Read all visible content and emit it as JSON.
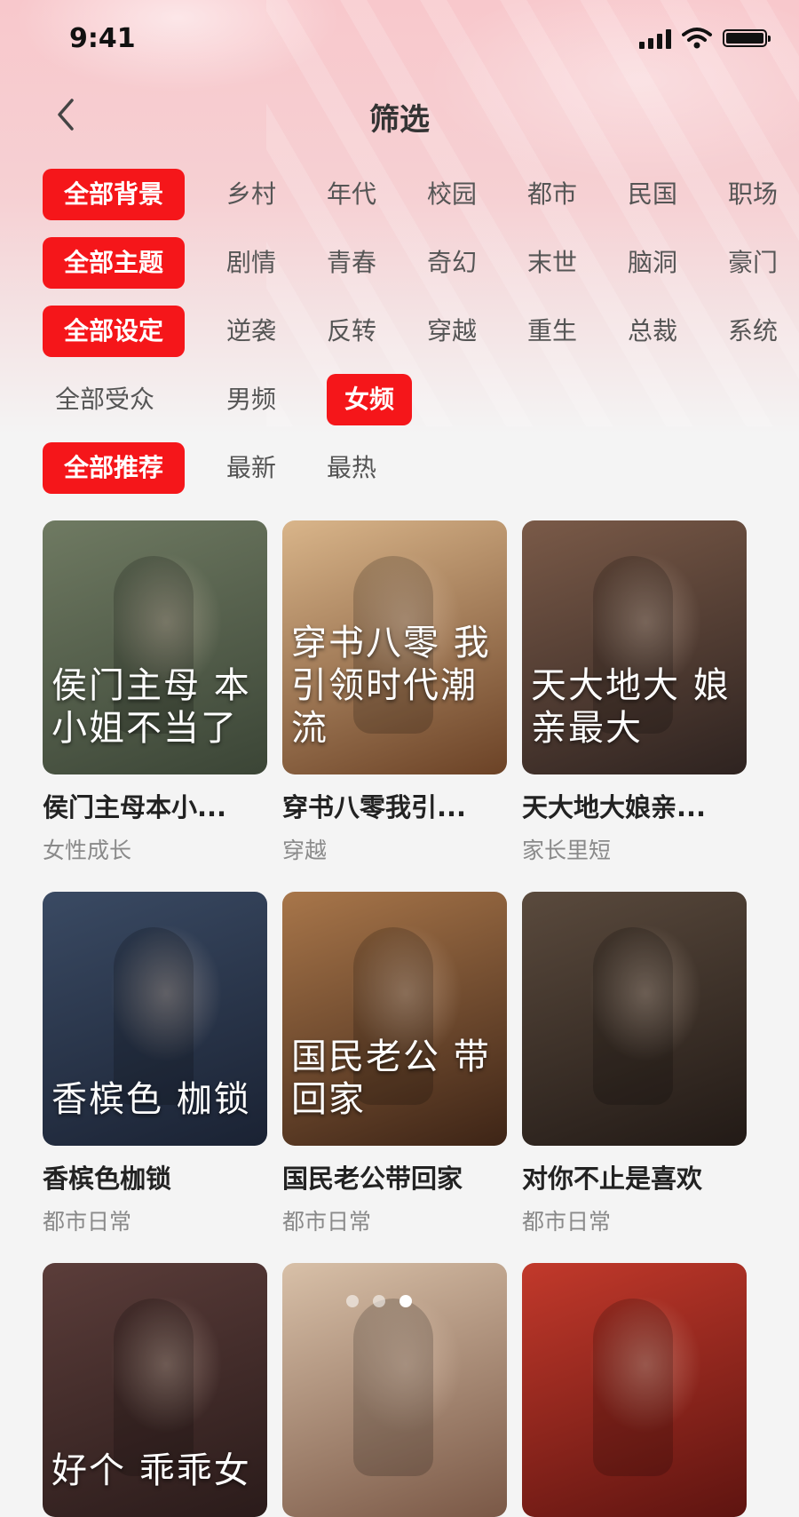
{
  "status_bar": {
    "time": "9:41"
  },
  "nav": {
    "title": "筛选"
  },
  "filters": [
    {
      "items": [
        "全部背景",
        "乡村",
        "年代",
        "校园",
        "都市",
        "民国",
        "职场"
      ],
      "active": 0
    },
    {
      "items": [
        "全部主题",
        "剧情",
        "青春",
        "奇幻",
        "末世",
        "脑洞",
        "豪门"
      ],
      "active": 0
    },
    {
      "items": [
        "全部设定",
        "逆袭",
        "反转",
        "穿越",
        "重生",
        "总裁",
        "系统"
      ],
      "active": 0
    },
    {
      "items": [
        "全部受众",
        "男频",
        "女频"
      ],
      "active": 2
    },
    {
      "items": [
        "全部推荐",
        "最新",
        "最热"
      ],
      "active": 0
    }
  ],
  "cards": [
    {
      "title": "侯门主母本小...",
      "tag": "女性成长",
      "poster_text": "侯门主母 本小姐不当了",
      "colors": [
        "#6f7a62",
        "#3b4536"
      ]
    },
    {
      "title": "穿书八零我引...",
      "tag": "穿越",
      "poster_text": "穿书八零 我引领时代潮流",
      "colors": [
        "#d9b58a",
        "#6b4226"
      ]
    },
    {
      "title": "天大地大娘亲...",
      "tag": "家长里短",
      "poster_text": "天大地大 娘亲最大",
      "colors": [
        "#7a5a48",
        "#2e2320"
      ]
    },
    {
      "title": "香槟色枷锁",
      "tag": "都市日常",
      "poster_text": "香槟色 枷锁",
      "colors": [
        "#3a4a63",
        "#1a2233"
      ]
    },
    {
      "title": "国民老公带回家",
      "tag": "都市日常",
      "poster_text": "国民老公 带回家",
      "colors": [
        "#a8764a",
        "#3d2416"
      ]
    },
    {
      "title": "对你不止是喜欢",
      "tag": "都市日常",
      "poster_text": "",
      "colors": [
        "#5a4a3d",
        "#221a16"
      ]
    },
    {
      "title": "",
      "tag": "",
      "poster_text": "好个 乖乖女",
      "colors": [
        "#5b3d3a",
        "#2a1b1a"
      ]
    },
    {
      "title": "",
      "tag": "",
      "poster_text": "",
      "colors": [
        "#d8c0a8",
        "#7a5846"
      ]
    },
    {
      "title": "",
      "tag": "",
      "poster_text": "",
      "colors": [
        "#c2392b",
        "#5e1410"
      ]
    }
  ],
  "pager": {
    "count": 3,
    "active": 2
  },
  "theme": {
    "accent": "#f5161a"
  }
}
